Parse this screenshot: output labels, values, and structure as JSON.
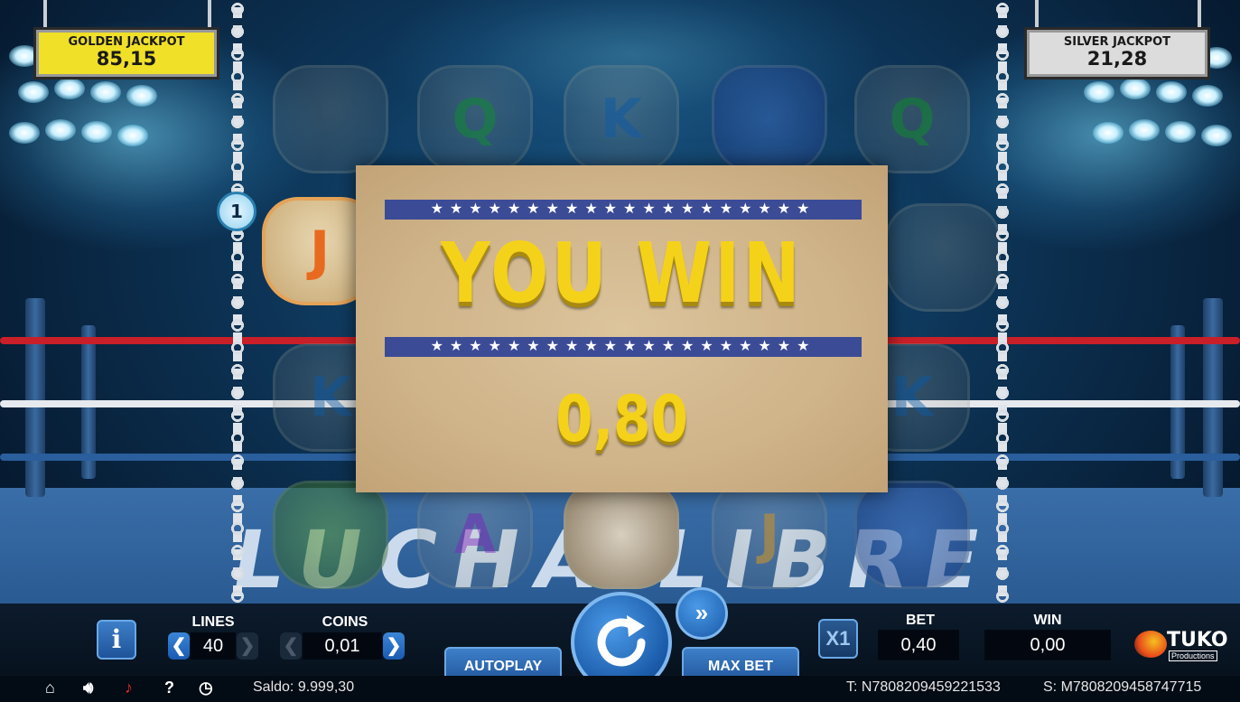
{
  "jackpots": {
    "golden": {
      "title": "GOLDEN JACKPOT",
      "value": "85,15",
      "color": "#f0e028"
    },
    "silver": {
      "title": "SILVER JACKPOT",
      "value": "21,28",
      "color": "#dcdcdc"
    }
  },
  "reels": {
    "row1": [
      "",
      "Q",
      "K",
      "",
      "Q"
    ],
    "row2": [
      "J",
      "",
      "",
      "",
      ""
    ],
    "row3": [
      "K",
      "",
      "",
      "",
      "K"
    ],
    "row4": [
      "",
      "A",
      "",
      "J",
      ""
    ]
  },
  "active_line": "1",
  "win_panel": {
    "stars": "★★★★★★★★★★★★★★★★★★★★",
    "title": "YOU WIN",
    "amount": "0,80"
  },
  "floor_logo": "LUCHA LIBRE",
  "controls": {
    "info_label": "i",
    "lines_label": "LINES",
    "lines_value": "40",
    "coins_label": "COINS",
    "coins_value": "0,01",
    "autoplay_label": "AUTOPLAY",
    "max_bet_label": "MAX BET",
    "multiplier_label": "X1",
    "bet_label": "BET",
    "bet_value": "0,40",
    "win_label": "WIN",
    "win_value": "0,00",
    "brand": "TUKO",
    "brand_sub": "Productions"
  },
  "status": {
    "saldo": "Saldo: 9.999,30",
    "ticket": "T: N7808209459221533",
    "session": "S: M7808209458747715"
  },
  "icons": [
    "home-icon",
    "volume-icon",
    "music-off-icon",
    "help-icon",
    "clock-icon",
    "spin-icon",
    "fast-forward-icon"
  ],
  "colors": {
    "accent": "#1f5399",
    "win_text": "#f5d21a",
    "stars_band": "#3b4b96"
  }
}
